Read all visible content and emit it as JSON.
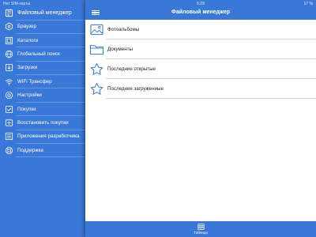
{
  "status": {
    "carrier": "Нет SIM-карты",
    "time": "5:28",
    "battery": "17 %"
  },
  "sidebar": {
    "items": [
      {
        "label": "Файловый менеджер",
        "icon": "file-manager-icon"
      },
      {
        "label": "Браузер",
        "icon": "browser-icon"
      },
      {
        "label": "Каталоги",
        "icon": "catalogs-icon"
      },
      {
        "label": "Глобальный поиск",
        "icon": "globe-icon"
      },
      {
        "label": "Загрузки",
        "icon": "download-icon"
      },
      {
        "label": "WiFi Трансфер",
        "icon": "wifi-icon"
      },
      {
        "label": "Настройки",
        "icon": "gear-icon"
      },
      {
        "label": "Покупки",
        "icon": "purchases-icon"
      },
      {
        "label": "Восстановить покупки",
        "icon": "restore-icon"
      },
      {
        "label": "Приложения разработчика",
        "icon": "developer-apps-icon"
      },
      {
        "label": "Поддержка",
        "icon": "support-icon"
      }
    ]
  },
  "nav": {
    "title": "Файловый менеджер"
  },
  "list": [
    {
      "label": "Фотоальбомы",
      "icon": "photo-album-icon"
    },
    {
      "label": "Документы",
      "icon": "folder-icon"
    },
    {
      "label": "Последние открытые",
      "icon": "star-icon"
    },
    {
      "label": "Последние загруженные",
      "icon": "star-icon"
    }
  ],
  "tabbar": {
    "label": "Таблица",
    "icon": "table-stack-icon"
  },
  "colors": {
    "primary": "#3a78d8",
    "icon_outline": "#3a78d8"
  }
}
